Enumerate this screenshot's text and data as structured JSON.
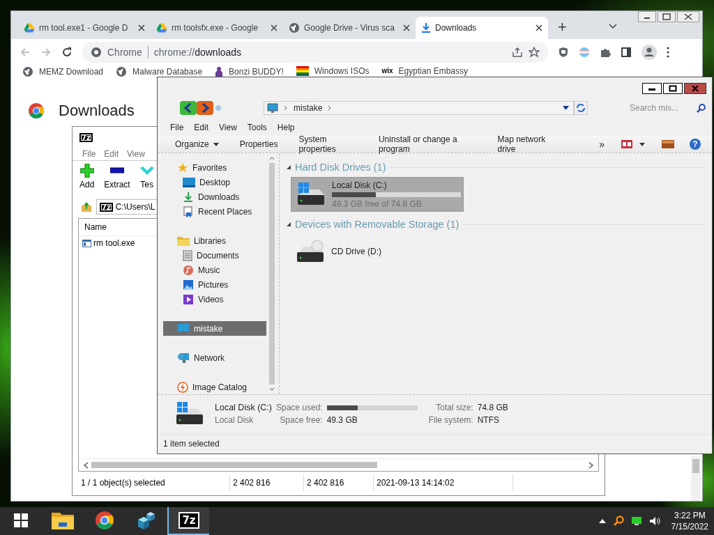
{
  "chrome": {
    "tabs": [
      {
        "title": "rm tool.exe1 - Google D",
        "selected": false
      },
      {
        "title": "rm toolsfx.exe - Google",
        "selected": false
      },
      {
        "title": "Google Drive - Virus sca",
        "selected": false
      },
      {
        "title": "Downloads",
        "selected": true
      }
    ],
    "new_tab": "+",
    "omnibox": {
      "origin": "Chrome",
      "url_scheme": "chrome://",
      "url_path": "downloads"
    },
    "bookmarks": [
      {
        "label": "MEMZ Download"
      },
      {
        "label": "Malware Database"
      },
      {
        "label": "Bonzi BUDDY!"
      },
      {
        "label": "Windows ISOs"
      },
      {
        "badge": "wix",
        "label": "Egyptian Embassy"
      }
    ],
    "page_title": "Downloads"
  },
  "sevenzip": {
    "title_badge": "7z",
    "menu": [
      "File",
      "Edit",
      "View"
    ],
    "toolbar": [
      "Add",
      "Extract",
      "Tes"
    ],
    "address_badge": "7z",
    "address": "C:\\Users\\L",
    "columns": [
      "Name"
    ],
    "rows": [
      {
        "name": "rm tool.exe",
        "selected": false
      }
    ],
    "status": [
      "1 / 1 object(s) selected",
      "2 402 816",
      "2 402 816",
      "2021-09-13 14:14:02"
    ]
  },
  "explorer": {
    "breadcrumb": [
      "mistake"
    ],
    "search": {
      "placeholder": "Search mis..."
    },
    "menu": [
      "File",
      "Edit",
      "View",
      "Tools",
      "Help"
    ],
    "commands": [
      "Organize",
      "Properties",
      "System properties",
      "Uninstall or change a program",
      "Map network drive"
    ],
    "overflow": "»",
    "help": "?",
    "nav": [
      {
        "label": "Favorites",
        "selected": false,
        "children": [
          {
            "label": "Desktop",
            "selected": false
          },
          {
            "label": "Downloads",
            "selected": false
          },
          {
            "label": "Recent Places",
            "selected": false
          }
        ]
      },
      {
        "label": "Libraries",
        "selected": false,
        "children": [
          {
            "label": "Documents",
            "selected": false
          },
          {
            "label": "Music",
            "selected": false
          },
          {
            "label": "Pictures",
            "selected": false
          },
          {
            "label": "Videos",
            "selected": false
          }
        ]
      },
      {
        "label": "mistake",
        "selected": true
      },
      {
        "label": "Network",
        "selected": false
      },
      {
        "label": "Image Catalog",
        "selected": false
      }
    ],
    "groups": [
      {
        "title": "Hard Disk Drives (1)",
        "items": [
          {
            "kind": "disk",
            "name": "Local Disk (C:)",
            "level": 0.34,
            "free": "49.3 GB free of 74.8 GB",
            "selected": true
          }
        ]
      },
      {
        "title": "Devices with Removable Storage (1)",
        "items": [
          {
            "kind": "cd",
            "name": "CD Drive (D:)",
            "selected": false
          }
        ]
      }
    ],
    "details": {
      "name": "Local Disk (C:)",
      "type": "Local Disk",
      "used_label": "Space used:",
      "level": 0.34,
      "free_label": "Space free:",
      "free": "49.3 GB",
      "total_label": "Total size:",
      "total": "74.8 GB",
      "fs_label": "File system:",
      "fs": "NTFS"
    },
    "status": "1 item selected"
  },
  "taskbar": {
    "apps": [
      {
        "selected": false
      },
      {
        "selected": false
      },
      {
        "selected": false
      },
      {
        "label": "7z",
        "selected": true
      }
    ],
    "clock": {
      "time": "3:22 PM",
      "date": "7/15/2022"
    }
  }
}
